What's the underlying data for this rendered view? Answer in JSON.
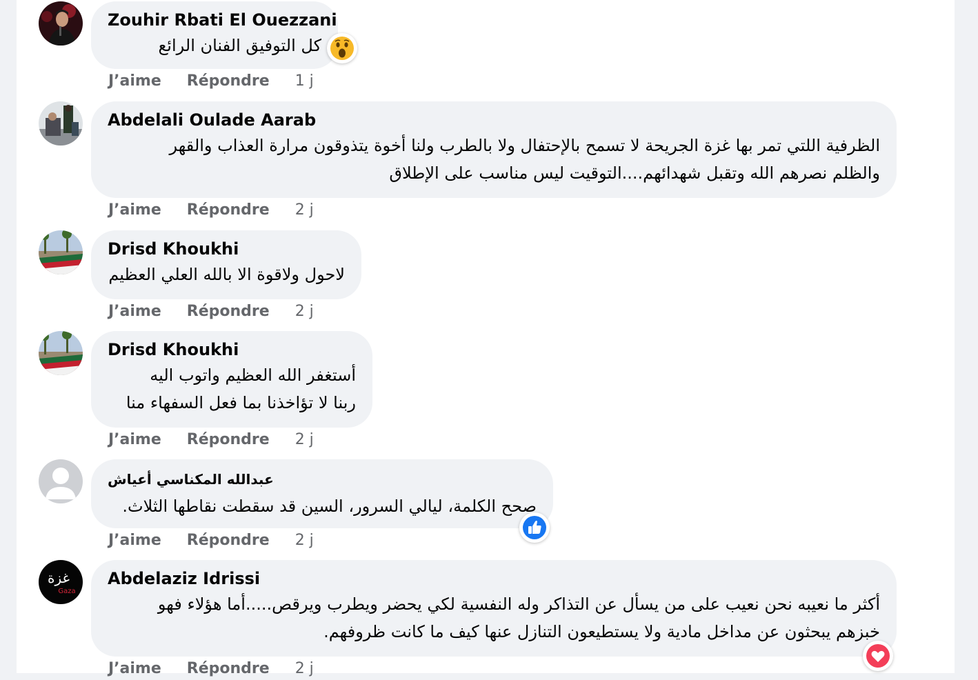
{
  "comments": [
    {
      "author": "Zouhir Rbati El Ouezzani",
      "lines": [
        "كل التوفيق الفنان الرائع"
      ],
      "like_label": "J’aime",
      "reply_label": "Répondre",
      "time": "1 j",
      "reaction": "wow-emoji-icon"
    },
    {
      "author": "Abdelali Oulade Aarab",
      "lines": [
        "الظرفية اللتي تمر بها غزة الجريحة لا تسمح بالإحتفال ولا بالطرب ولنا أخوة يتذوقون مرارة العذاب والقهر",
        "والظلم نصرهم الله وتقبل شهدائهم....التوقيت ليس مناسب على الإطلاق"
      ],
      "like_label": "J’aime",
      "reply_label": "Répondre",
      "time": "2 j"
    },
    {
      "author": "Drisd Khoukhi",
      "lines": [
        "لاحول ولاقوة الا بالله العلي العظيم"
      ],
      "like_label": "J’aime",
      "reply_label": "Répondre",
      "time": "2 j"
    },
    {
      "author": "Drisd Khoukhi",
      "lines": [
        "أستغفر الله العظيم واتوب اليه",
        "ربنا لا تؤاخذنا بما فعل السفهاء منا"
      ],
      "like_label": "J’aime",
      "reply_label": "Répondre",
      "time": "2 j"
    },
    {
      "author": "عبدالله المكناسي أعياش",
      "lines": [
        "صحح الكلمة، ليالي السرور، السين قد سقطت نقاطها الثلاث."
      ],
      "like_label": "J’aime",
      "reply_label": "Répondre",
      "time": "2 j",
      "reaction": "like-thumb-icon"
    },
    {
      "author": "Abdelaziz Idrissi",
      "lines": [
        "أكثر ما نعيبه نحن نعيب على من يسأل عن التذاكر وله النفسية لكي يحضر ويطرب ويرقص.....أما هؤلاء فهو",
        "خبزهم يبحثون عن مداخل مادية ولا يستطيعون التنازل عنها كيف ما كانت ظروفهم."
      ],
      "like_label": "J’aime",
      "reply_label": "Répondre",
      "time": "2 j",
      "reaction": "heart-icon",
      "avatar_text": "غزة",
      "avatar_subtext": "Gaza"
    }
  ],
  "colors": {
    "page_bg": "#f0f2f5",
    "panel_bg": "#ffffff",
    "bubble_bg": "#f0f2f5",
    "text": "#050505",
    "meta": "#65676b",
    "like_blue": "#1877f2",
    "heart_red": "#f33e58"
  }
}
